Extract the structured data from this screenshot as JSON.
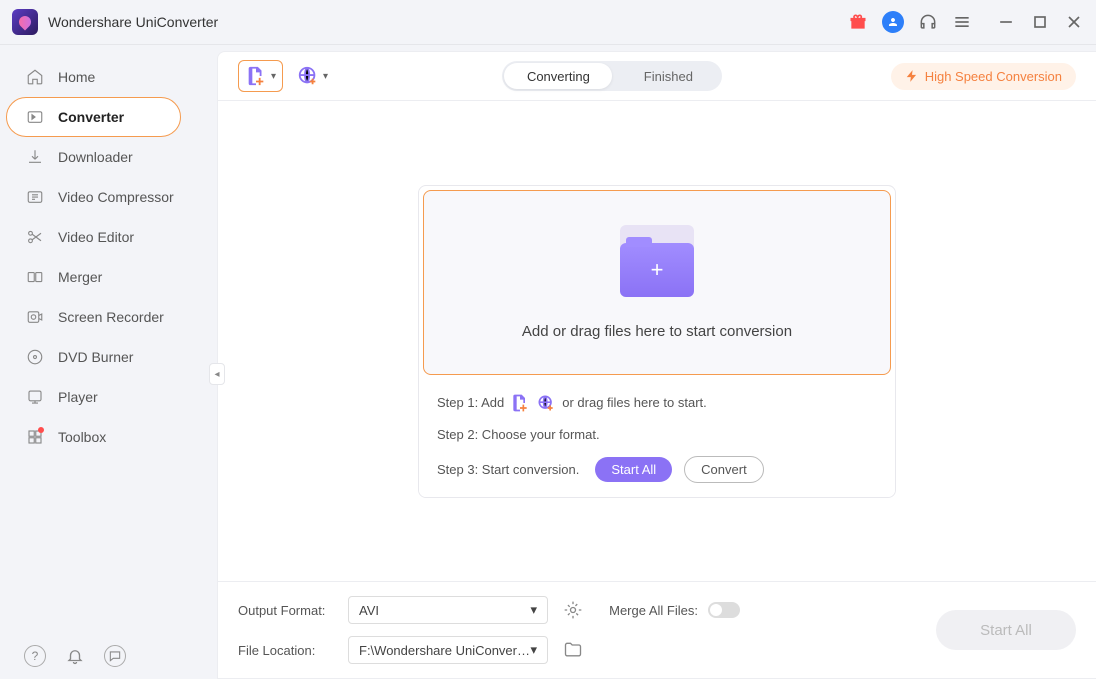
{
  "app": {
    "title": "Wondershare UniConverter"
  },
  "sidebar": {
    "items": [
      {
        "label": "Home"
      },
      {
        "label": "Converter"
      },
      {
        "label": "Downloader"
      },
      {
        "label": "Video Compressor"
      },
      {
        "label": "Video Editor"
      },
      {
        "label": "Merger"
      },
      {
        "label": "Screen Recorder"
      },
      {
        "label": "DVD Burner"
      },
      {
        "label": "Player"
      },
      {
        "label": "Toolbox"
      }
    ]
  },
  "tabs": {
    "converting": "Converting",
    "finished": "Finished"
  },
  "topbar": {
    "speed": "High Speed Conversion"
  },
  "dropzone": {
    "caption": "Add or drag files here to start conversion"
  },
  "steps": {
    "s1_prefix": "Step 1: Add",
    "s1_suffix": "or drag files here to start.",
    "s2": "Step 2: Choose your format.",
    "s3": "Step 3: Start conversion.",
    "start_all": "Start All",
    "convert": "Convert"
  },
  "footer": {
    "output_format_label": "Output Format:",
    "output_format_value": "AVI",
    "file_location_label": "File Location:",
    "file_location_value": "F:\\Wondershare UniConverter",
    "merge_label": "Merge All Files:",
    "start_all": "Start All"
  }
}
